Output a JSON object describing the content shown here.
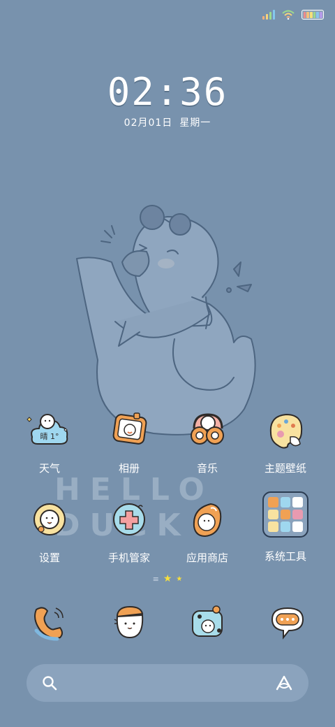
{
  "status_bar": {
    "signal_colors": [
      "#f5b07b",
      "#f7d37c",
      "#9ddc8c",
      "#84c8ec"
    ],
    "wifi_icon": "wifi-icon",
    "battery_colors": [
      "#f08a8a",
      "#f5c07a",
      "#f5e07a",
      "#9ad88c",
      "#8ac4ee",
      "#b59ae8"
    ]
  },
  "clock": {
    "time": "02:36"
  },
  "date": {
    "day": "02月01日",
    "weekday": "星期一"
  },
  "wallpaper": {
    "caption": "HELLO DUCK"
  },
  "apps": [
    {
      "label": "天气",
      "icon": "weather-icon",
      "badge": "晴 1°"
    },
    {
      "label": "相册",
      "icon": "gallery-icon"
    },
    {
      "label": "音乐",
      "icon": "music-icon"
    },
    {
      "label": "主题壁纸",
      "icon": "theme-palette-icon"
    },
    {
      "label": "设置",
      "icon": "settings-icon"
    },
    {
      "label": "手机管家",
      "icon": "phone-manager-icon"
    },
    {
      "label": "应用商店",
      "icon": "app-store-icon"
    },
    {
      "label": "系统工具",
      "icon": "system-tools-folder-icon"
    }
  ],
  "page_indicator": {
    "pages": 3,
    "current": 2
  },
  "dock": [
    {
      "icon": "phone-icon"
    },
    {
      "icon": "contacts-icon"
    },
    {
      "icon": "camera-icon"
    },
    {
      "icon": "messages-icon"
    }
  ],
  "search": {
    "placeholder": "",
    "search_icon": "search-icon",
    "assistant_icon": "assistant-icon"
  },
  "colors": {
    "background": "#7892ad",
    "accent_orange": "#f0a154",
    "outline": "#3a2e2a"
  }
}
